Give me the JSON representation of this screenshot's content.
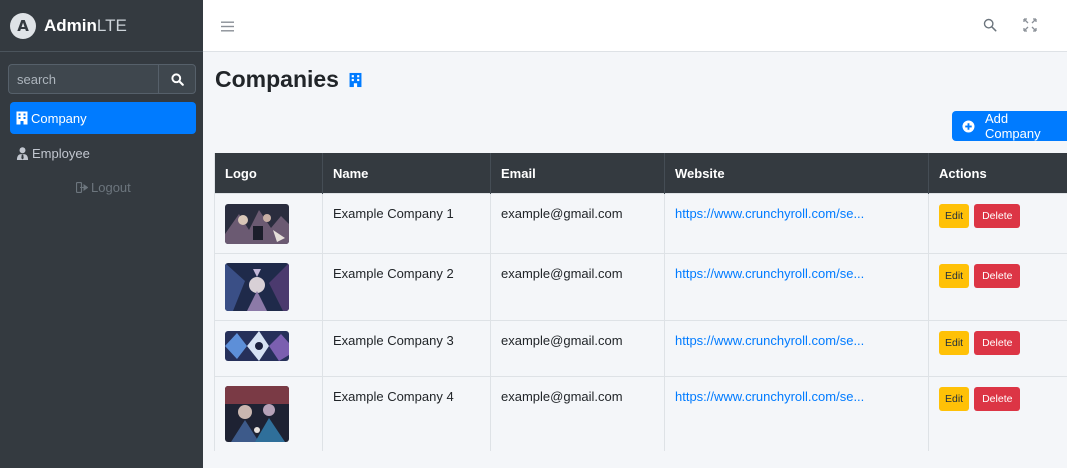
{
  "brand": {
    "name_bold": "Admin",
    "name_light": "LTE"
  },
  "sidebar": {
    "search_placeholder": "search",
    "items": [
      {
        "label": "Company",
        "icon": "building-icon",
        "active": true
      },
      {
        "label": "Employee",
        "icon": "user-tie-icon",
        "active": false
      }
    ],
    "logout_label": "Logout"
  },
  "page": {
    "title": "Companies",
    "add_button_label": "Add Company"
  },
  "table": {
    "columns": [
      "Logo",
      "Name",
      "Email",
      "Website",
      "Actions"
    ],
    "rows": [
      {
        "name": "Example Company 1",
        "email": "example@gmail.com",
        "website": "https://www.crunchyroll.com/se...",
        "edit": "Edit",
        "delete": "Delete"
      },
      {
        "name": "Example Company 2",
        "email": "example@gmail.com",
        "website": "https://www.crunchyroll.com/se...",
        "edit": "Edit",
        "delete": "Delete"
      },
      {
        "name": "Example Company 3",
        "email": "example@gmail.com",
        "website": "https://www.crunchyroll.com/se...",
        "edit": "Edit",
        "delete": "Delete"
      },
      {
        "name": "Example Company 4",
        "email": "example@gmail.com",
        "website": "https://www.crunchyroll.com/se...",
        "edit": "Edit",
        "delete": "Delete"
      }
    ]
  },
  "colors": {
    "sidebar": "#343a40",
    "primary": "#007bff",
    "warning": "#ffc107",
    "danger": "#dc3545",
    "table_header": "#343a40"
  }
}
